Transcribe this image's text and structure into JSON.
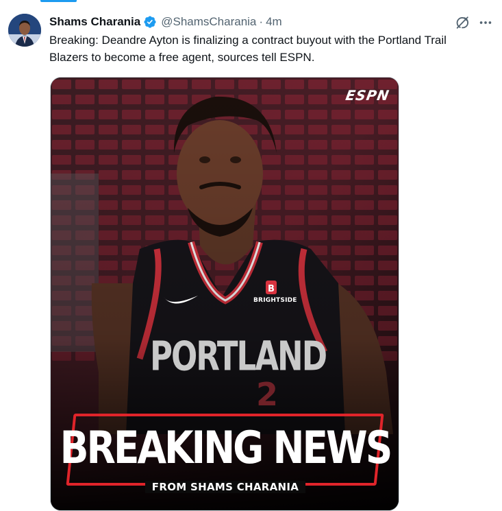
{
  "author": {
    "name": "Shams Charania",
    "handle": "@ShamsCharania",
    "separator": "·",
    "time": "4m",
    "verified": true
  },
  "tweet": {
    "text": "Breaking: Deandre Ayton is finalizing a contract buyout with the Portland Trail Blazers to become a free agent, sources tell ESPN."
  },
  "media": {
    "logo": "ESPN",
    "jersey_team": "PORTLAND",
    "jersey_sponsor": "BRIGHTSIDE",
    "headline": "BREAKING NEWS",
    "subheadline": "FROM SHAMS CHARANIA"
  },
  "icons": {
    "verified": "verified-badge-icon",
    "grok": "grok-icon",
    "more": "more-icon"
  },
  "colors": {
    "accent": "#1d9bf0",
    "text_primary": "#0f1419",
    "text_secondary": "#536471",
    "breaking_red": "#e0242a"
  }
}
